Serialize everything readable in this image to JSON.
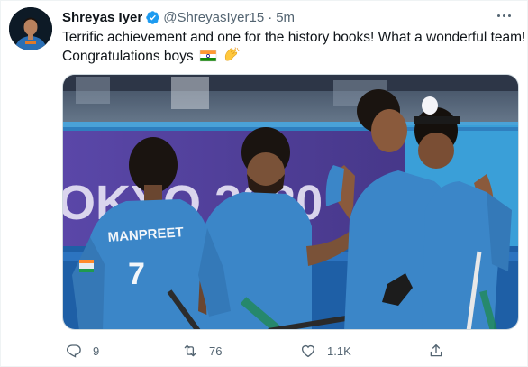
{
  "tweet": {
    "display_name": "Shreyas Iyer",
    "handle": "@ShreyasIyer15",
    "separator": "·",
    "time": "5m",
    "text_line1": "Terrific achievement and one for the history books! What a wonderful team!",
    "text_line2": "Congratulations boys",
    "emojis": [
      "indian-flag",
      "clapping-hands"
    ]
  },
  "image": {
    "stadium_sign_text": "OKYO 2020",
    "jersey_name": "MANPREET",
    "jersey_number": "7"
  },
  "actions": {
    "reply_count": "9",
    "retweet_count": "76",
    "like_count": "1.1K"
  },
  "colors": {
    "verified_blue": "#1d9bf0",
    "muted_text": "#536471",
    "jersey_blue": "#3b86c8",
    "backdrop_purple": "#4f3f9a"
  }
}
